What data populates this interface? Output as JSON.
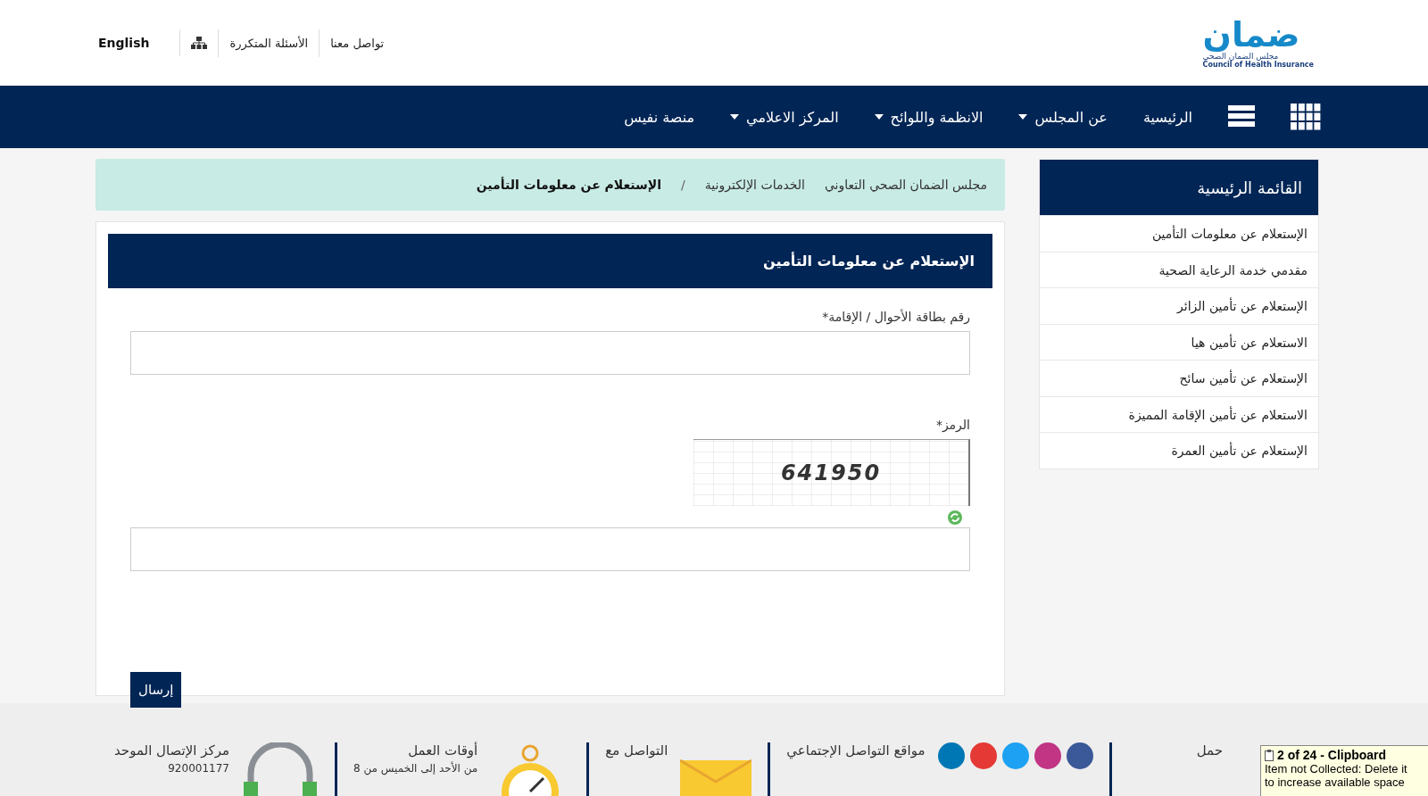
{
  "header": {
    "logo": {
      "name": "ضمان",
      "subtitle": "مجلس الضمان الصحي",
      "english_name": "Council of Health Insurance"
    },
    "top_links": [
      {
        "label": "تواصل معنا"
      },
      {
        "label": "الأسئلة المتكررة"
      }
    ],
    "language": "English"
  },
  "nav": {
    "items": [
      {
        "label": "الرئيسية",
        "dropdown": false
      },
      {
        "label": "عن المجلس",
        "dropdown": true
      },
      {
        "label": "الانظمة واللوائح",
        "dropdown": true
      },
      {
        "label": "المركز الاعلامي",
        "dropdown": true
      },
      {
        "label": "منصة نفيس",
        "dropdown": false
      }
    ]
  },
  "sidebar": {
    "title": "القائمة الرئيسية",
    "items": [
      "الإستعلام عن معلومات التأمين",
      "مقدمي خدمة الرعاية الصحية",
      "الإستعلام عن تأمين الزائر",
      "الاستعلام عن تأمين هيا",
      "الإستعلام عن تأمين سائح",
      "الاستعلام عن تأمين الإقامة المميزة",
      "الإستعلام عن تأمين العمرة"
    ]
  },
  "breadcrumb": {
    "items": [
      "مجلس الضمان الصحي التعاوني",
      "الخدمات الإلكترونية"
    ],
    "separator": "/",
    "current": "الإستعلام عن معلومات التأمين"
  },
  "form": {
    "title": "الإستعلام عن معلومات التأمين",
    "fields": [
      {
        "kind": "text",
        "label": "رقم بطاقة الأحوال / الإقامة*"
      },
      {
        "kind": "captcha",
        "label": "الرمز*",
        "captcha_code": "641950"
      }
    ],
    "submit": "إرسال"
  },
  "footer": {
    "columns": [
      {
        "kind": "download",
        "title": "حمل"
      },
      {
        "kind": "social",
        "title": "مواقع التواصل الإجتماعي"
      },
      {
        "kind": "mail",
        "title": "التواصل مع"
      },
      {
        "kind": "clock",
        "title": "أوقات العمل",
        "text": "من الأحد إلى الخميس من 8"
      },
      {
        "kind": "phone",
        "title": "مركز الإتصال الموحد",
        "text": "920001177"
      }
    ]
  },
  "clipboard": {
    "title": "2 of 24 - Clipboard",
    "lines": [
      "Item not Collected: Delete it",
      "to increase available space"
    ]
  }
}
